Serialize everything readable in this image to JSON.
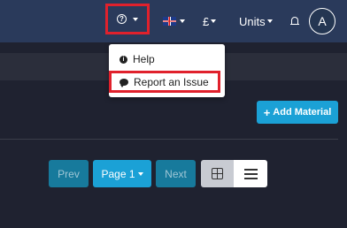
{
  "navbar": {
    "help_toggle": {
      "icon": "question-circle-icon"
    },
    "language": {
      "icon": "uk-flag-icon"
    },
    "currency": {
      "label": "£"
    },
    "units": {
      "label": "Units"
    },
    "notifications": {
      "icon": "bell-icon"
    },
    "avatar": {
      "initial": "A"
    }
  },
  "help_menu": {
    "items": [
      {
        "label": "Help",
        "icon": "info-circle-icon"
      },
      {
        "label": "Report an Issue",
        "icon": "comment-icon"
      }
    ]
  },
  "toolbar": {
    "add_material_label": "Add Material",
    "add_icon": "+"
  },
  "pagination": {
    "prev_label": "Prev",
    "page_label": "Page 1",
    "next_label": "Next"
  },
  "view_toggle": {
    "grid_icon": "grid-view-icon",
    "list_icon": "list-view-icon",
    "active": "grid"
  },
  "colors": {
    "navbar": "#2a3a5b",
    "background": "#1f2230",
    "accent": "#1ba1d6",
    "highlight": "#e0212c"
  }
}
